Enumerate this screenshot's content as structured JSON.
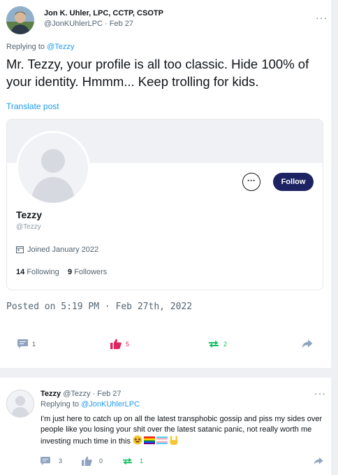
{
  "tweet": {
    "author_name": "Jon K. Uhler, LPC, CCTP, CSOTP",
    "author_handle": "@JonKUhlerLPC",
    "sep": "·",
    "date": "Feb 27",
    "more": "···",
    "replying_prefix": "Replying to ",
    "replying_handle": "@Tezzy",
    "text": "Mr. Tezzy, your profile is all too classic. Hide 100% of your identity. Hmmm... Keep trolling for kids.",
    "translate_label": "Translate post",
    "posted_on": "Posted on 5:19 PM · Feb 27th, 2022",
    "actions": {
      "replies": "1",
      "likes": "5",
      "retweets": "2"
    }
  },
  "profile_card": {
    "name": "Tezzy",
    "handle": "@Tezzy",
    "more_label": "···",
    "follow_label": "Follow",
    "joined": "Joined January 2022",
    "following_count": "14",
    "following_label": "Following",
    "followers_count": "9",
    "followers_label": "Followers"
  },
  "reply": {
    "author_name": "Tezzy",
    "author_handle": "@Tezzy",
    "sep": "·",
    "date": "Feb 27",
    "more": "···",
    "replying_prefix": "Replying to ",
    "replying_handle": "@JonKUhlerLPC",
    "text": "I'm just here to catch up on all the latest transphobic gossip and piss my sides over people like you losing your shit over the latest satanic panic, not really worth me investing much time in this",
    "actions": {
      "replies": "3",
      "likes": "0",
      "retweets": "1"
    }
  },
  "colors": {
    "link": "#1d9bf0",
    "follow_bg": "#1c2262",
    "like_red": "#e0245e",
    "retweet_green": "#17bf63",
    "muted_icon": "#8fa3c0"
  },
  "icons": [
    "comment-icon",
    "thumbs-up-icon",
    "retweet-icon",
    "share-arrow-icon",
    "calendar-icon",
    "more-icon"
  ]
}
